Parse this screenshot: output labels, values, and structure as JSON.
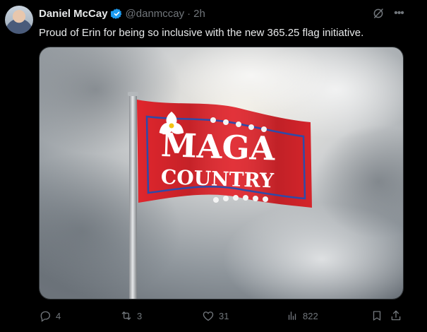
{
  "post": {
    "author_name": "Daniel McCay",
    "handle": "@danmccay",
    "separator": "·",
    "timestamp": "2h",
    "text": "Proud of Erin for being so inclusive with the new 365.25 flag initiative."
  },
  "media": {
    "flag_line1": "MAGA",
    "flag_line2": "COUNTRY"
  },
  "actions": {
    "replies": "4",
    "reposts": "3",
    "likes": "31",
    "views": "822"
  },
  "icons": {
    "verified": "verified-badge-icon",
    "grok": "grok-icon",
    "more": "more-icon",
    "reply": "reply-icon",
    "repost": "repost-icon",
    "like": "like-icon",
    "views": "views-icon",
    "bookmark": "bookmark-icon",
    "share": "share-icon"
  },
  "colors": {
    "background": "#000000",
    "text": "#e7e9ea",
    "muted": "#71767b",
    "verified": "#1d9bf0",
    "flag_red": "#e0262d"
  }
}
